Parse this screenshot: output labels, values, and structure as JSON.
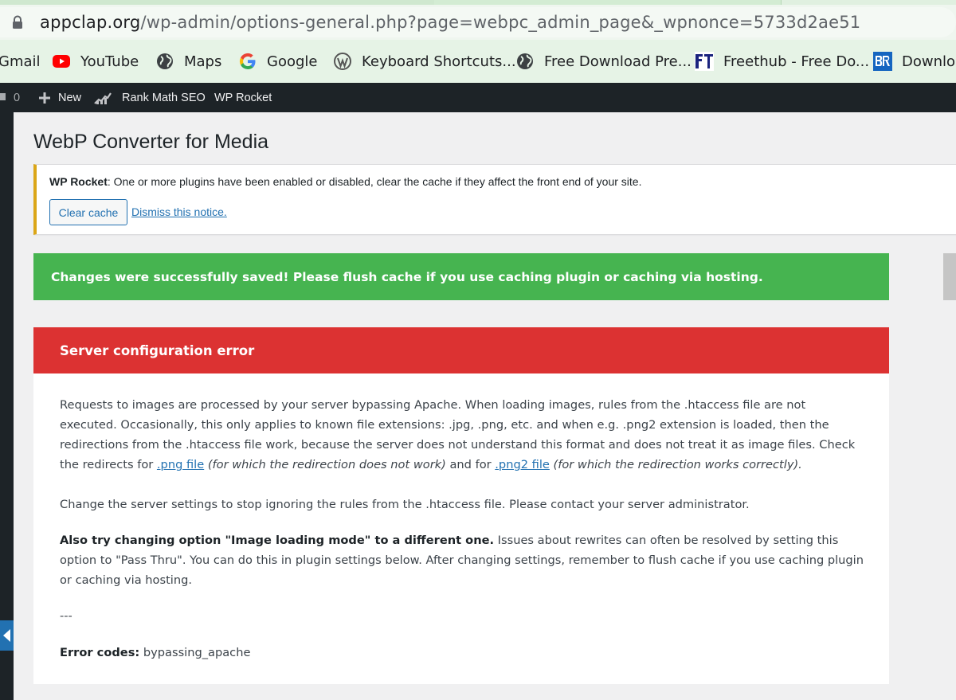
{
  "browser": {
    "url_host": "appclap.org",
    "url_path": "/wp-admin/options-general.php?page=webpc_admin_page&_wpnonce=5733d2ae51",
    "bookmarks": [
      {
        "label": "Gmail",
        "icon": "gmail-icon"
      },
      {
        "label": "YouTube",
        "icon": "youtube-icon"
      },
      {
        "label": "Maps",
        "icon": "globe-icon"
      },
      {
        "label": "Google",
        "icon": "google-icon"
      },
      {
        "label": "Keyboard Shortcuts...",
        "icon": "wordpress-icon"
      },
      {
        "label": "Free Download Pre...",
        "icon": "globe-icon"
      },
      {
        "label": "Freethub - Free Do...",
        "icon": "freethub-icon"
      },
      {
        "label": "Downloa",
        "icon": "br-icon"
      }
    ]
  },
  "adminbar": {
    "comments_count": "0",
    "new_label": "New",
    "rankmath_label": "Rank Math SEO",
    "rocket_label": "WP Rocket"
  },
  "page": {
    "title": "WebP Converter for Media"
  },
  "notice": {
    "plugin": "WP Rocket",
    "message": ": One or more plugins have been enabled or disabled, clear the cache if they affect the front end of your site.",
    "clear_button": "Clear cache",
    "dismiss_link": "Dismiss this notice."
  },
  "success": {
    "message": "Changes were successfully saved! Please flush cache if you use caching plugin or caching via hosting."
  },
  "error": {
    "title": "Server configuration error",
    "p1_text": "Requests to images are processed by your server bypassing Apache. When loading images, rules from the .htaccess file are not executed. Occasionally, this only applies to known file extensions: .jpg, .png, etc. and when e.g. .png2 extension is loaded, then the redirections from the .htaccess file work, because the server does not understand this format and does not treat it as image files. Check the redirects for ",
    "png_link": ".png file",
    "png_note": "(for which the redirection does not work)",
    "and_for": " and for ",
    "png2_link": ".png2 file",
    "png2_note": "(for which the redirection works correctly).",
    "p2": "Change the server settings to stop ignoring the rules from the .htaccess file. Please contact your server administrator.",
    "p3_strong": "Also try changing option \"Image loading mode\" to a different one.",
    "p3_rest": " Issues about rewrites can often be resolved by setting this option to \"Pass Thru\". You can do this in plugin settings below. After changing settings, remember to flush cache if you use caching plugin or caching via hosting.",
    "separator": "---",
    "codes_label": "Error codes:",
    "codes_value": " bypassing_apache"
  },
  "colors": {
    "success": "#46b450",
    "error": "#dc3232",
    "notice_border": "#dba617",
    "link": "#2271b1",
    "adminbar": "#1d2327"
  }
}
